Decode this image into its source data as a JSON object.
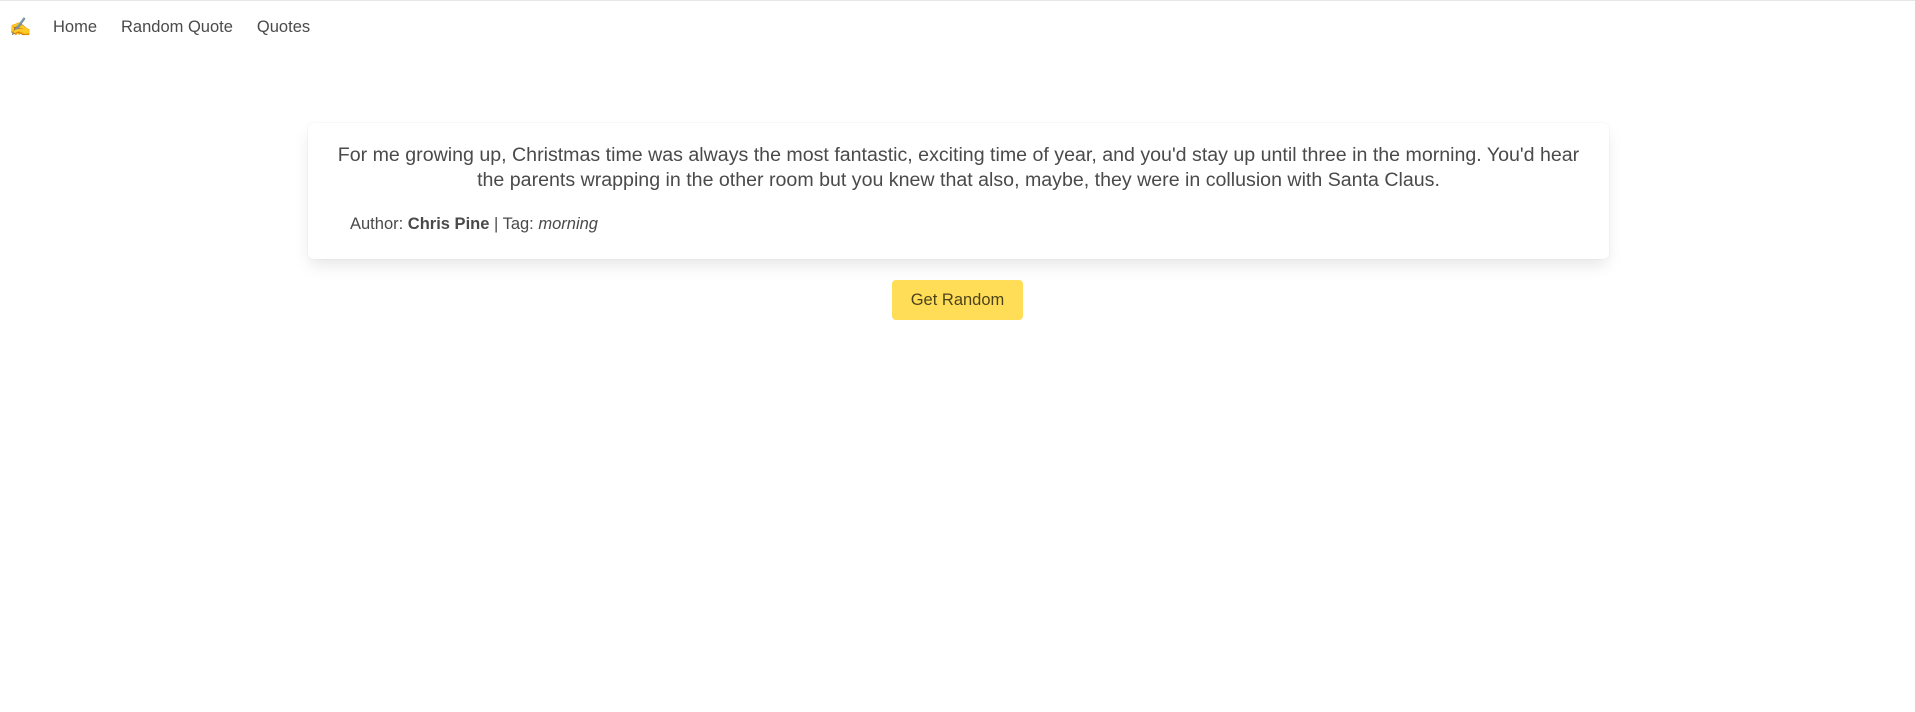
{
  "navbar": {
    "brand_icon": "✍️",
    "items": [
      {
        "label": "Home"
      },
      {
        "label": "Random Quote"
      },
      {
        "label": "Quotes"
      }
    ]
  },
  "quote": {
    "text": "For me growing up, Christmas time was always the most fantastic, exciting time of year, and you'd stay up until three in the morning. You'd hear the parents wrapping in the other room but you knew that also, maybe, they were in collusion with Santa Claus.",
    "author_label": "Author: ",
    "author": "Chris Pine",
    "separator": " | ",
    "tag_label": "Tag: ",
    "tag": "morning"
  },
  "actions": {
    "get_random_label": "Get Random"
  },
  "colors": {
    "button_background": "#ffdd57",
    "text": "#4a4a4a"
  }
}
